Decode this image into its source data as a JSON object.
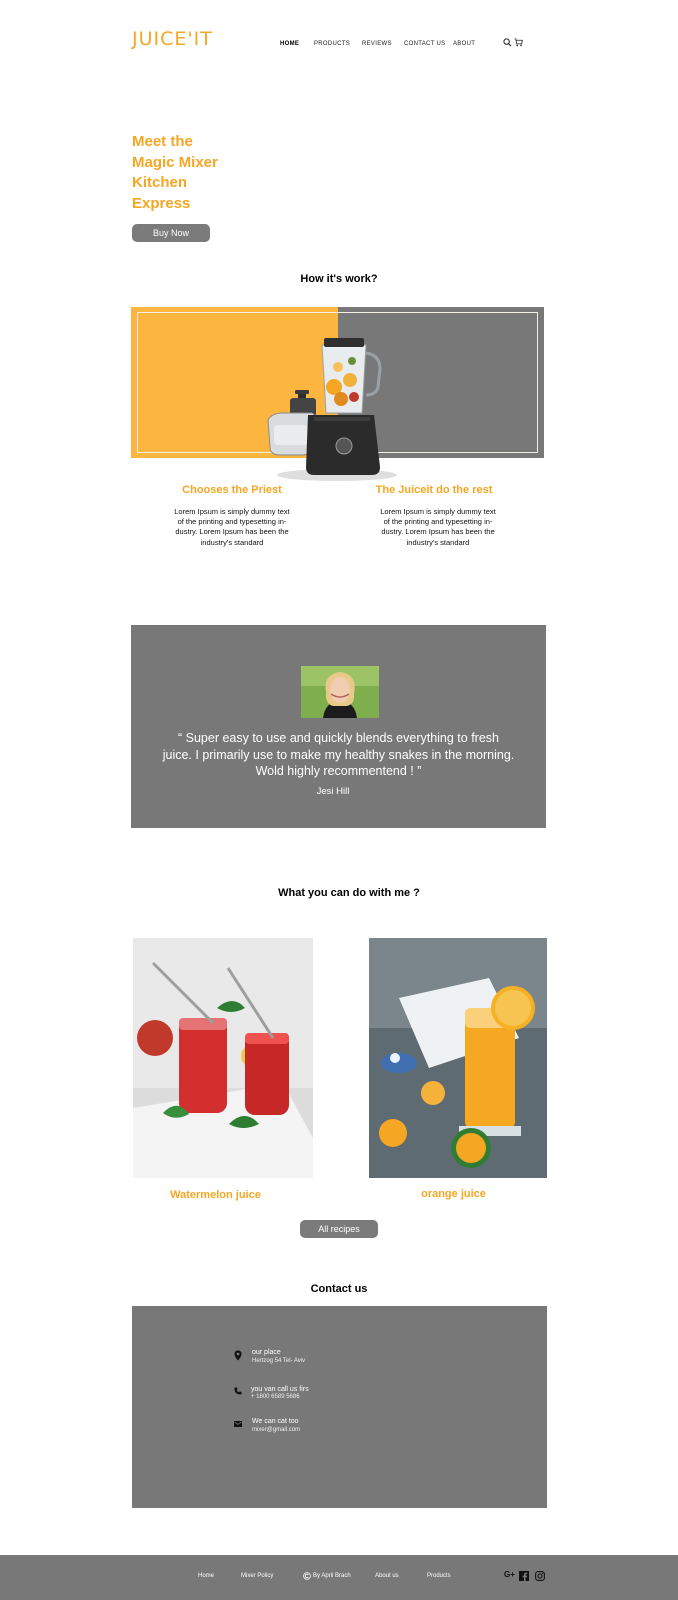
{
  "header": {
    "logo": "JUICE'IT",
    "nav": [
      "HOME",
      "PRODUCTS",
      "REVIEWS",
      "CONTACT US",
      "ABOUT"
    ],
    "icons": [
      "search-icon",
      "cart-icon"
    ]
  },
  "hero": {
    "title_lines": [
      "Meet the",
      "Magic Mixer",
      "Kitchen",
      "Express"
    ],
    "button": "Buy Now"
  },
  "how": {
    "title": "How it's work?",
    "steps": [
      {
        "title": "Chooses the Priest",
        "text_lines": [
          "Lorem Ipsum is simply dummy text",
          "of the printing and typesetting in-",
          "dustry. Lorem Ipsum has been the",
          "industry's standard"
        ]
      },
      {
        "title": "The Juiceit  do the rest",
        "text_lines": [
          "Lorem Ipsum is simply dummy text",
          "of the printing and typesetting in-",
          "dustry. Lorem Ipsum has been the",
          "industry's standard"
        ]
      }
    ]
  },
  "testimonial": {
    "quote_lines": [
      "“ Super easy to use and quickly blends everything to fresh",
      "juice. I primarily use to make my healthy snakes in the morning.",
      "Wold highly recommentend ! ”"
    ],
    "author": "Jesi Hill"
  },
  "recipes": {
    "title": "What you can do with me ?",
    "items": [
      {
        "label": "Watermelon juice"
      },
      {
        "label": "orange juice"
      }
    ],
    "button": "All recipes"
  },
  "contact": {
    "title": "Contact us",
    "rows": [
      {
        "icon": "location-pin-icon",
        "line1": "our place",
        "line2": "Hertzog 54 Tel- Aviv"
      },
      {
        "icon": "phone-icon",
        "line1": "you van call us firs",
        "line2": "+ 1800 6589 5686"
      },
      {
        "icon": "mail-icon",
        "line1": "We can cat too",
        "line2": "mixer@gmail.com"
      }
    ]
  },
  "footer": {
    "links": [
      "Home",
      "Mixer Policy",
      "By April Brach",
      "About us",
      "Products"
    ],
    "social": [
      "G+",
      "facebook-icon",
      "instagram-icon"
    ]
  },
  "colors": {
    "accent": "#f5a623",
    "panel_yellow": "#fcb53f",
    "gray": "#787878"
  }
}
